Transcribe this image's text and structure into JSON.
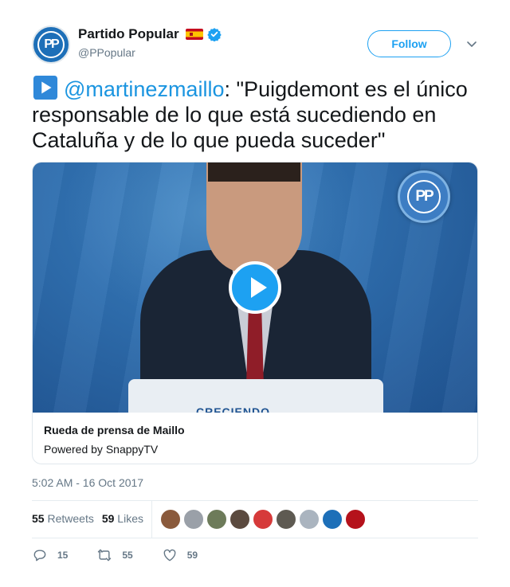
{
  "author": {
    "display_name": "Partido Popular",
    "handle": "@PPopular",
    "avatar_text": "PP",
    "flag_icon": "spain-flag-icon",
    "verified_icon": "verified-badge-icon"
  },
  "header": {
    "follow_label": "Follow",
    "menu_icon": "chevron-down-icon"
  },
  "tweet": {
    "emoji_icon": "play-button-emoji-icon",
    "mention": "@martinezmaillo",
    "text": ": \"Puigdemont es el único responsable de lo que está sucediendo en Cataluña y de lo que pueda suceder\""
  },
  "card": {
    "logo_text": "PP",
    "podium_text": "CRECIENDO",
    "title": "Rueda de prensa de Maillo",
    "subtitle": "Powered by SnappyTV",
    "play_icon": "play-icon"
  },
  "timestamp": "5:02 AM - 16 Oct 2017",
  "stats": {
    "retweets_count": "55",
    "retweets_label": "Retweets",
    "likes_count": "59",
    "likes_label": "Likes"
  },
  "likers": [
    "#8a5a3c",
    "#9aa0a8",
    "#6d7b5a",
    "#5b4a3f",
    "#d63a3a",
    "#5e5a52",
    "#aab4bf",
    "#1d6fb8",
    "#b5121b"
  ],
  "actions": {
    "reply_count": "15",
    "retweet_count": "55",
    "like_count": "59"
  },
  "colors": {
    "accent": "#1da1f2",
    "mention": "#1b95e0",
    "muted": "#657786"
  }
}
